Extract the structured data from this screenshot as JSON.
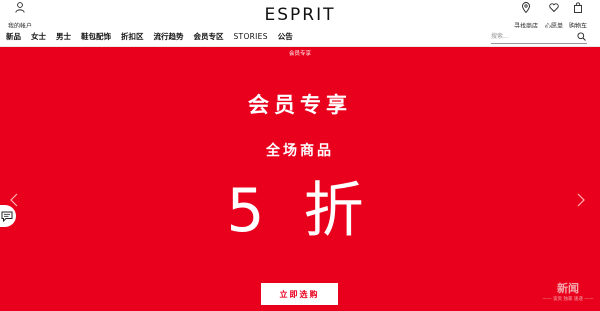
{
  "header": {
    "account_label": "我的帐户",
    "logo_text": "ESPRIT",
    "utility": [
      {
        "label": "寻找商店",
        "icon": "location-pin-icon"
      },
      {
        "label": "心愿单",
        "icon": "heart-icon"
      },
      {
        "label": "购物车",
        "icon": "shopping-bag-icon"
      }
    ]
  },
  "nav": {
    "items": [
      {
        "label": "新品"
      },
      {
        "label": "女士"
      },
      {
        "label": "男士"
      },
      {
        "label": "鞋包配饰"
      },
      {
        "label": "折扣区"
      },
      {
        "label": "流行趋势"
      },
      {
        "label": "会员专区"
      },
      {
        "label": "STORIES"
      },
      {
        "label": "公告"
      }
    ]
  },
  "search": {
    "placeholder": "搜索...",
    "icon": "search-icon"
  },
  "banner": {
    "tag": "会员专享",
    "headline": "会员专享",
    "subheadline": "全场商品",
    "discount": "5 折",
    "cta_label": "立即选购",
    "background_color": "#e8001c",
    "text_color": "#ffffff"
  },
  "watermark": {
    "title": "新闻",
    "subtitle": "—— 谈资 独家 速递 ——"
  }
}
